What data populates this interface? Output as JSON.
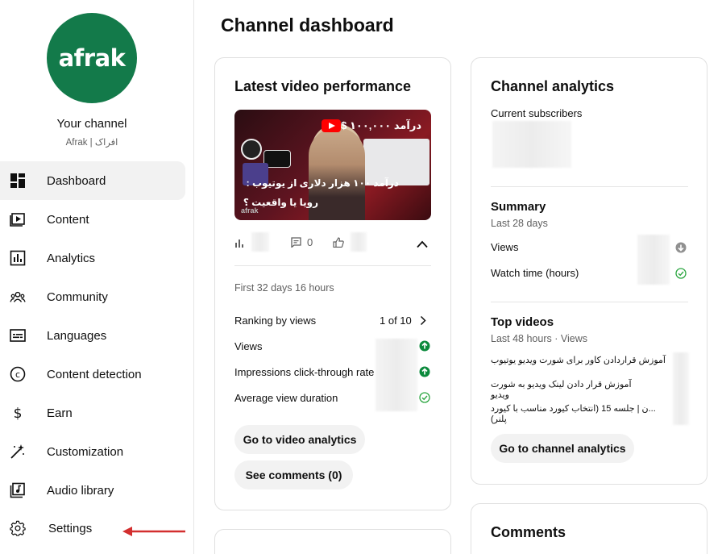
{
  "sidebar": {
    "logo_text": "afrak",
    "your_channel": "Your channel",
    "channel_name": "Afrak | افراک",
    "items": [
      {
        "label": "Dashboard",
        "icon": "dashboard-icon",
        "active": true
      },
      {
        "label": "Content",
        "icon": "content-icon"
      },
      {
        "label": "Analytics",
        "icon": "analytics-icon"
      },
      {
        "label": "Community",
        "icon": "community-icon"
      },
      {
        "label": "Languages",
        "icon": "languages-icon"
      },
      {
        "label": "Content detection",
        "icon": "copyright-icon"
      },
      {
        "label": "Earn",
        "icon": "dollar-icon"
      },
      {
        "label": "Customization",
        "icon": "magic-wand-icon"
      },
      {
        "label": "Audio library",
        "icon": "audio-library-icon"
      },
      {
        "label": "Settings",
        "icon": "gear-icon"
      }
    ],
    "annotation_arrow_color": "#d32f2f"
  },
  "main": {
    "title": "Channel dashboard",
    "latest_video": {
      "title": "Latest video performance",
      "thumbnail": {
        "headline": "درآمد ۱۰۰,۰۰۰ $",
        "line1": "درآمد ۱۰۰ هزار دلاری از یوتیوب :",
        "line2": "رویا یا واقعیت ؟",
        "brand": "afrak"
      },
      "comments_count": "0",
      "period": "First 32 days 16 hours",
      "ranking_label": "Ranking by views",
      "ranking_value": "1 of 10",
      "metrics": [
        {
          "label": "Views",
          "status": "up"
        },
        {
          "label": "Impressions click-through rate",
          "status": "up"
        },
        {
          "label": "Average view duration",
          "status": "ok"
        }
      ],
      "btn_analytics": "Go to video analytics",
      "btn_comments": "See comments (0)"
    },
    "channel_analytics": {
      "title": "Channel analytics",
      "subscribers_label": "Current subscribers",
      "summary_title": "Summary",
      "summary_period": "Last 28 days",
      "summary_rows": [
        {
          "label": "Views",
          "status": "down"
        },
        {
          "label": "Watch time (hours)",
          "status": "ok"
        }
      ],
      "top_videos_title": "Top videos",
      "top_videos_period": "Last 48 hours · Views",
      "top_videos": [
        "آموزش قراردادن کاور برای شورت ویدیو یوتیوب",
        "آموزش قرار دادن لینک ویدیو به شورت ویدیو",
        "...ن | جلسه 15 (انتخاب کیورد مناسب با کیورد پلنر)"
      ],
      "btn": "Go to channel analytics"
    },
    "comments_card_title": "Comments"
  },
  "colors": {
    "brand_green": "#137a4a",
    "status_green": "#0b8a3c",
    "youtube_red": "#ff0000"
  }
}
